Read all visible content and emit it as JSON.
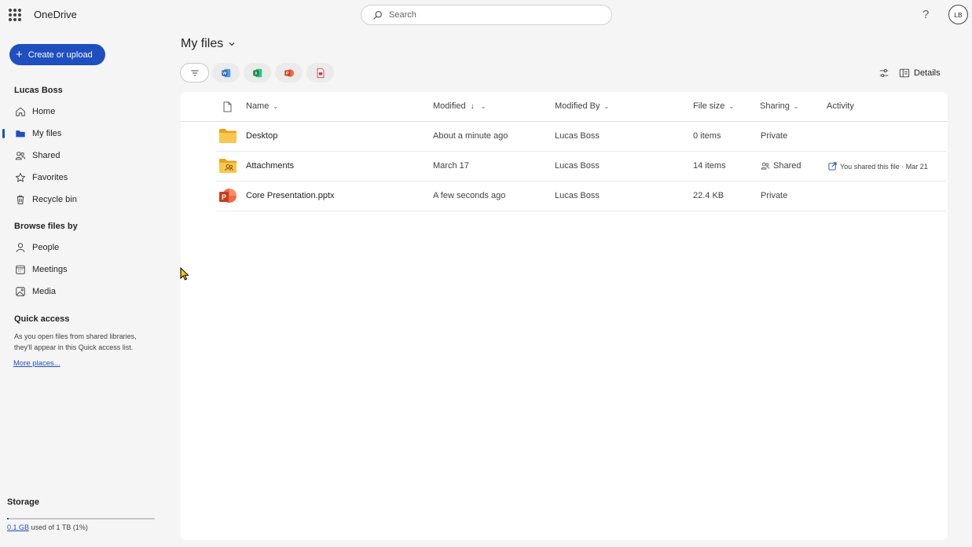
{
  "header": {
    "app_title": "OneDrive",
    "search_placeholder": "Search",
    "help_glyph": "?",
    "avatar_initials": "LB"
  },
  "sidebar": {
    "create_label": "Create or upload",
    "user_name": "Lucas Boss",
    "items": [
      {
        "label": "Home",
        "icon": "home-icon"
      },
      {
        "label": "My files",
        "icon": "folder-icon",
        "active": true
      },
      {
        "label": "Shared",
        "icon": "people-icon"
      },
      {
        "label": "Favorites",
        "icon": "star-icon"
      },
      {
        "label": "Recycle bin",
        "icon": "trash-icon"
      }
    ],
    "browse_heading": "Browse files by",
    "browse_items": [
      {
        "label": "People",
        "icon": "person-icon"
      },
      {
        "label": "Meetings",
        "icon": "calendar-icon"
      },
      {
        "label": "Media",
        "icon": "image-icon"
      }
    ],
    "quick_access_heading": "Quick access",
    "quick_access_text": "As you open files from shared libraries, they'll appear in this Quick access list.",
    "more_places": "More places...",
    "storage": {
      "heading": "Storage",
      "used_link": "0.1 GB",
      "used_rest": "used of 1 TB (1%)",
      "fraction": 0.01
    }
  },
  "main": {
    "title": "My files",
    "details_label": "Details",
    "columns": {
      "name": "Name",
      "modified": "Modified",
      "modified_by": "Modified By",
      "file_size": "File size",
      "sharing": "Sharing",
      "activity": "Activity"
    },
    "rows": [
      {
        "name": "Desktop",
        "type": "folder",
        "modified": "About a minute ago",
        "modified_by": "Lucas Boss",
        "size": "0 items",
        "sharing": "Private",
        "activity": ""
      },
      {
        "name": "Attachments",
        "type": "shared-folder",
        "modified": "March 17",
        "modified_by": "Lucas Boss",
        "size": "14 items",
        "sharing": "Shared",
        "activity": "You shared this file · Mar 21"
      },
      {
        "name": "Core Presentation.pptx",
        "type": "pptx",
        "modified": "A few seconds ago",
        "modified_by": "Lucas Boss",
        "size": "22.4 KB",
        "sharing": "Private",
        "activity": ""
      }
    ]
  },
  "colors": {
    "accent": "#1f4fbf",
    "folder": "#f4c430",
    "word": "#185abd",
    "excel": "#107c41",
    "powerpoint": "#c43e1c",
    "pdf": "#d13438"
  }
}
